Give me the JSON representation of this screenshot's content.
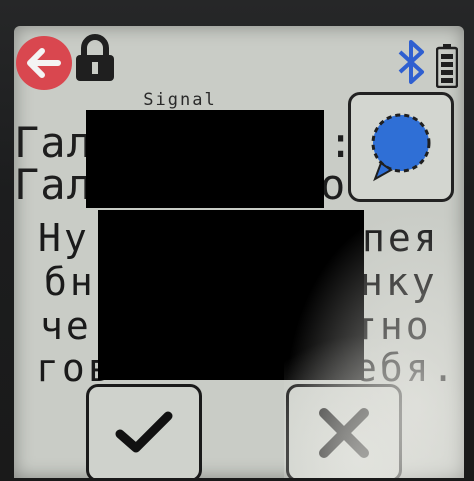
{
  "status_bar": {
    "back_icon": "arrow-left-icon",
    "lock_icon": "lock-icon",
    "bluetooth_icon": "bluetooth-icon",
    "battery_icon": "battery-icon",
    "back_color": "#d9474f"
  },
  "conversation": {
    "app_name": "Signal",
    "title_line_1": "Гал",
    "title_line_1_end": ":",
    "title_line_2": "Гал",
    "title_line_2_end": "о",
    "avatar_icon": "signal-chat-icon",
    "avatar_color": "#2f6fd6"
  },
  "message": {
    "line_1_start": "Ну",
    "line_1_end": "пея",
    "line_2_start": "бн",
    "line_2_end": "нку",
    "line_3_start": "че",
    "line_3_end": "тно",
    "line_4_start": "гов",
    "line_4_end": "ебя..."
  },
  "actions": {
    "accept_icon": "checkmark-icon",
    "reject_icon": "close-icon"
  }
}
